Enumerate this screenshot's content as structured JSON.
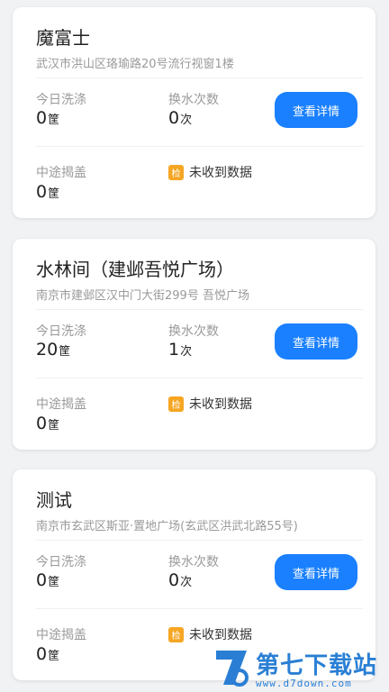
{
  "stores": [
    {
      "name": "魔富士",
      "address": "武汉市洪山区珞瑜路20号流行视窗1楼",
      "wash_label": "今日洗涤",
      "wash_value": "0",
      "wash_unit": "筐",
      "water_label": "换水次数",
      "water_value": "0",
      "water_unit": "次",
      "detail_label": "查看详情",
      "lid_label": "中途揭盖",
      "lid_value": "0",
      "lid_unit": "筐",
      "inspect_badge": "检",
      "inspect_text": "未收到数据"
    },
    {
      "name": "水林间（建邺吾悦广场）",
      "address": "南京市建邺区汉中门大街299号 吾悦广场",
      "wash_label": "今日洗涤",
      "wash_value": "20",
      "wash_unit": "筐",
      "water_label": "换水次数",
      "water_value": "1",
      "water_unit": "次",
      "detail_label": "查看详情",
      "lid_label": "中途揭盖",
      "lid_value": "0",
      "lid_unit": "筐",
      "inspect_badge": "检",
      "inspect_text": "未收到数据"
    },
    {
      "name": "测试",
      "address": "南京市玄武区斯亚·置地广场(玄武区洪武北路55号)",
      "wash_label": "今日洗涤",
      "wash_value": "0",
      "wash_unit": "筐",
      "water_label": "换水次数",
      "water_value": "0",
      "water_unit": "次",
      "detail_label": "查看详情",
      "lid_label": "中途揭盖",
      "lid_value": "0",
      "lid_unit": "筐",
      "inspect_badge": "检",
      "inspect_text": "未收到数据"
    }
  ],
  "watermark": {
    "title": "第七下载站",
    "url": "www.d7down.com"
  },
  "colors": {
    "accent": "#1a80ff",
    "badge": "#f5a623",
    "watermark": "#2a7fd4"
  }
}
